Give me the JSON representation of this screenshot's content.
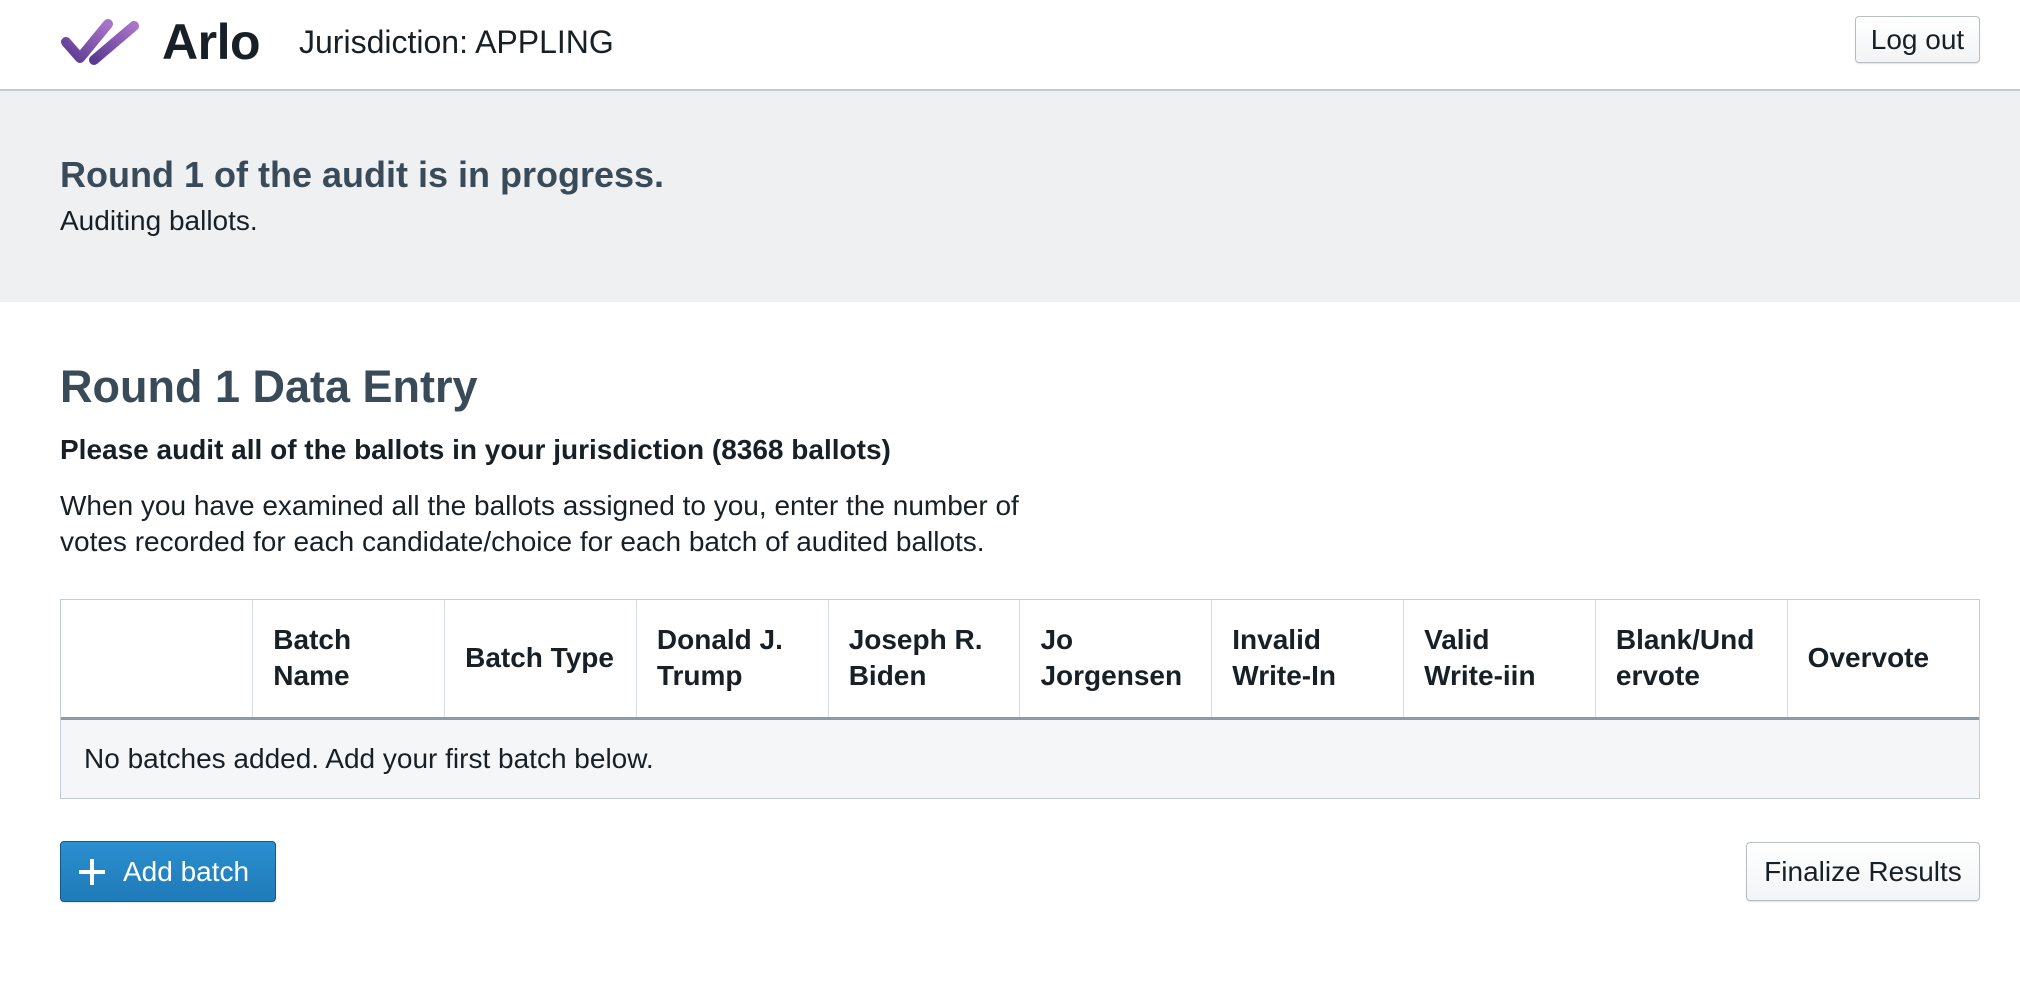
{
  "colors": {
    "primary": "#2b8fd0",
    "heading": "#394b59",
    "banner_bg": "#eef0f2",
    "logo_purple_dark": "#5b3a92",
    "logo_purple_light": "#a874c8"
  },
  "header": {
    "logo_icon": "arlo-checkmark-logo",
    "logo_text": "Arlo",
    "jurisdiction": "Jurisdiction: APPLING",
    "logout_label": "Log out"
  },
  "status": {
    "title": "Round 1 of the audit is in progress.",
    "subtitle": "Auditing ballots."
  },
  "main": {
    "title": "Round 1 Data Entry",
    "instruction": "Please audit all of the ballots in your jurisdiction (8368 ballots)",
    "description": "When you have examined all the ballots assigned to you, enter the number of votes recorded for each candidate/choice for each batch of audited ballots."
  },
  "table": {
    "columns": [
      "",
      "Batch Name",
      "Batch Type",
      "Donald J. Trump",
      "Joseph R. Biden",
      "Jo Jorgensen",
      "Invalid Write-In",
      "Valid Write-iin",
      "Blank/Und ervote",
      "Overvote"
    ],
    "empty_message": "No batches added. Add your first batch below."
  },
  "actions": {
    "add_batch_icon": "plus-icon",
    "add_batch_label": "Add batch",
    "finalize_label": "Finalize Results"
  }
}
